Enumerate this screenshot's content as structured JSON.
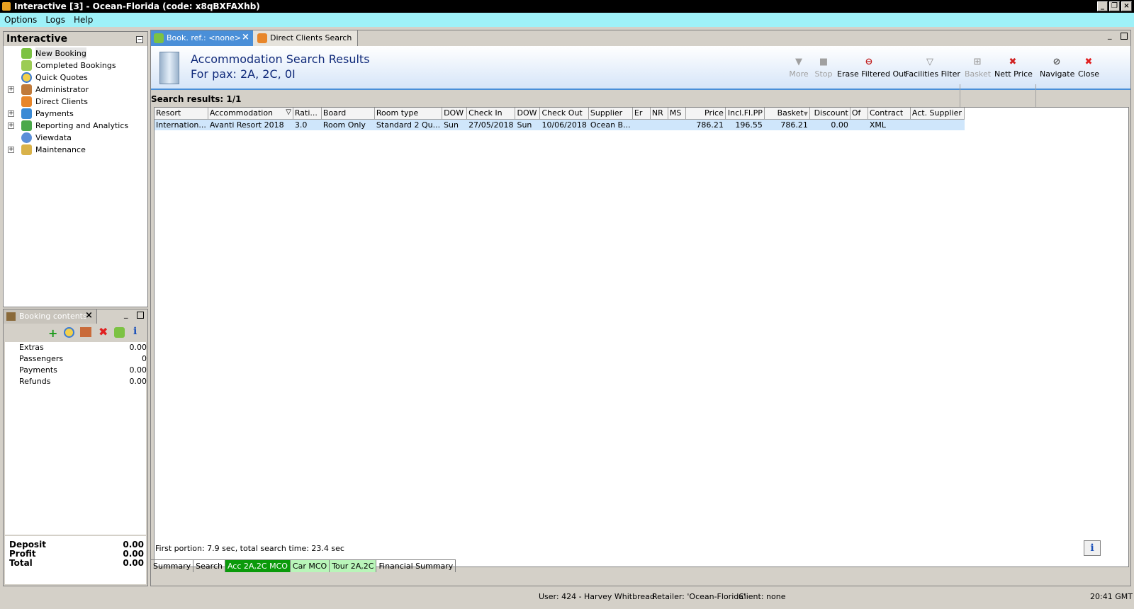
{
  "window": {
    "title": "Interactive [3] - Ocean-Florida (code: x8qBXFAXhb)"
  },
  "menu": [
    "Options",
    "Logs",
    "Help"
  ],
  "nav": {
    "title": "Interactive",
    "items": [
      {
        "label": "New Booking"
      },
      {
        "label": "Completed Bookings"
      },
      {
        "label": "Quick Quotes"
      },
      {
        "label": "Administrator"
      },
      {
        "label": "Direct Clients"
      },
      {
        "label": "Payments"
      },
      {
        "label": "Reporting and Analytics"
      },
      {
        "label": "Viewdata"
      },
      {
        "label": "Maintenance"
      }
    ]
  },
  "booking_contents": {
    "title": "Booking contents",
    "rows": [
      {
        "label": "Extras",
        "value": "0.00"
      },
      {
        "label": "Passengers",
        "value": "0"
      },
      {
        "label": "Payments",
        "value": "0.00"
      },
      {
        "label": "Refunds",
        "value": "0.00"
      }
    ],
    "totals": [
      {
        "label": "Deposit",
        "value": "0.00"
      },
      {
        "label": "Profit",
        "value": "0.00"
      },
      {
        "label": "Total",
        "value": "0.00"
      }
    ]
  },
  "tabs": [
    {
      "label": "Book. ref.: <none>"
    },
    {
      "label": "Direct Clients Search"
    }
  ],
  "header": {
    "title": "Accommodation Search Results",
    "subtitle": "For pax: 2A, 2C, 0I"
  },
  "toolbar": [
    {
      "label": "More",
      "enabled": false
    },
    {
      "label": "Stop",
      "enabled": false
    },
    {
      "label": "Erase Filtered Out",
      "enabled": true
    },
    {
      "label": "Facilities Filter",
      "enabled": true
    },
    {
      "label": "Basket",
      "enabled": false
    },
    {
      "label": "Nett Price",
      "enabled": true
    },
    {
      "label": "Navigate",
      "enabled": true
    },
    {
      "label": "Close",
      "enabled": true
    }
  ],
  "results_label": "Search results: 1/1",
  "table": {
    "columns": [
      "Resort",
      "Accommodation",
      "Rati...",
      "Board",
      "Room type",
      "DOW",
      "Check In",
      "DOW",
      "Check Out",
      "Supplier",
      "Er",
      "NR",
      "MS",
      "Price",
      "Incl.Fl.PP",
      "Basket",
      "Discount",
      "Of",
      "Contract",
      "Act. Supplier"
    ],
    "rows": [
      [
        "Internation...",
        "Avanti Resort 2018",
        "3.0",
        "Room Only",
        "Standard 2 Qu...",
        "Sun",
        "27/05/2018",
        "Sun",
        "10/06/2018",
        "Ocean B...",
        "",
        "",
        "",
        "786.21",
        "196.55",
        "786.21",
        "0.00",
        "",
        "XML",
        ""
      ]
    ]
  },
  "search_time": "First portion: 7.9 sec, total search time: 23.4 sec",
  "bottom_tabs": [
    {
      "label": "Summary",
      "style": "plain"
    },
    {
      "label": "Search",
      "style": "plain"
    },
    {
      "label": "Acc 2A,2C MCO",
      "style": "green"
    },
    {
      "label": "Car MCO",
      "style": "lgreen"
    },
    {
      "label": "Tour 2A,2C",
      "style": "lgreen"
    },
    {
      "label": "Financial Summary",
      "style": "plain"
    }
  ],
  "status": {
    "user": "User: 424 - Harvey Whitbread",
    "retailer": "Retailer: 'Ocean-Florida'",
    "client": "Client: none",
    "time": "20:41 GMT"
  },
  "colors": {
    "menubar": "#9ef1f8",
    "selected_row": "#cfe6fb",
    "tab_active": "#0a9a0a",
    "tab_light": "#b9f5b9"
  }
}
